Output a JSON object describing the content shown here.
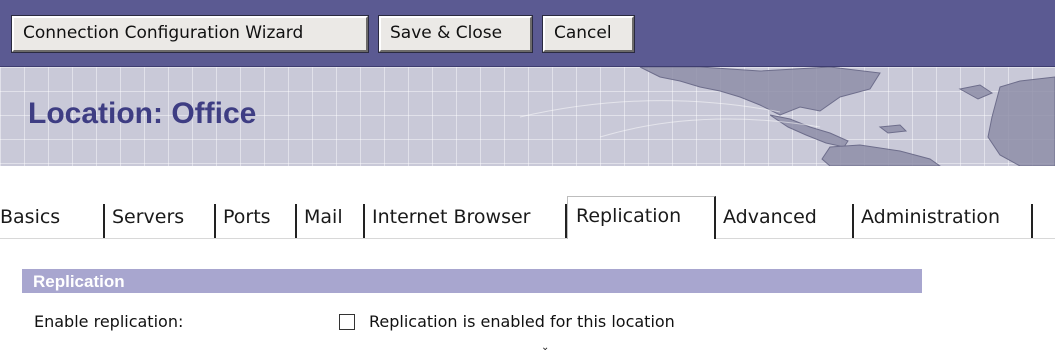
{
  "toolbar": {
    "wizard_label": "Connection Configuration Wizard",
    "save_close_label": "Save & Close",
    "cancel_label": "Cancel"
  },
  "banner": {
    "title": "Location: Office"
  },
  "tabs": [
    {
      "label": "Basics"
    },
    {
      "label": "Servers"
    },
    {
      "label": "Ports"
    },
    {
      "label": "Mail"
    },
    {
      "label": "Internet Browser"
    },
    {
      "label": "Replication",
      "active": true
    },
    {
      "label": "Advanced"
    },
    {
      "label": "Administration"
    }
  ],
  "section": {
    "title": "Replication",
    "enable_label": "Enable replication:",
    "checkbox_label": "Replication is enabled for this location",
    "checkbox_checked": false
  },
  "colors": {
    "toolbar_bg": "#5b5a92",
    "title_text": "#3e3d83",
    "section_header_bg": "#a8a6cf"
  }
}
